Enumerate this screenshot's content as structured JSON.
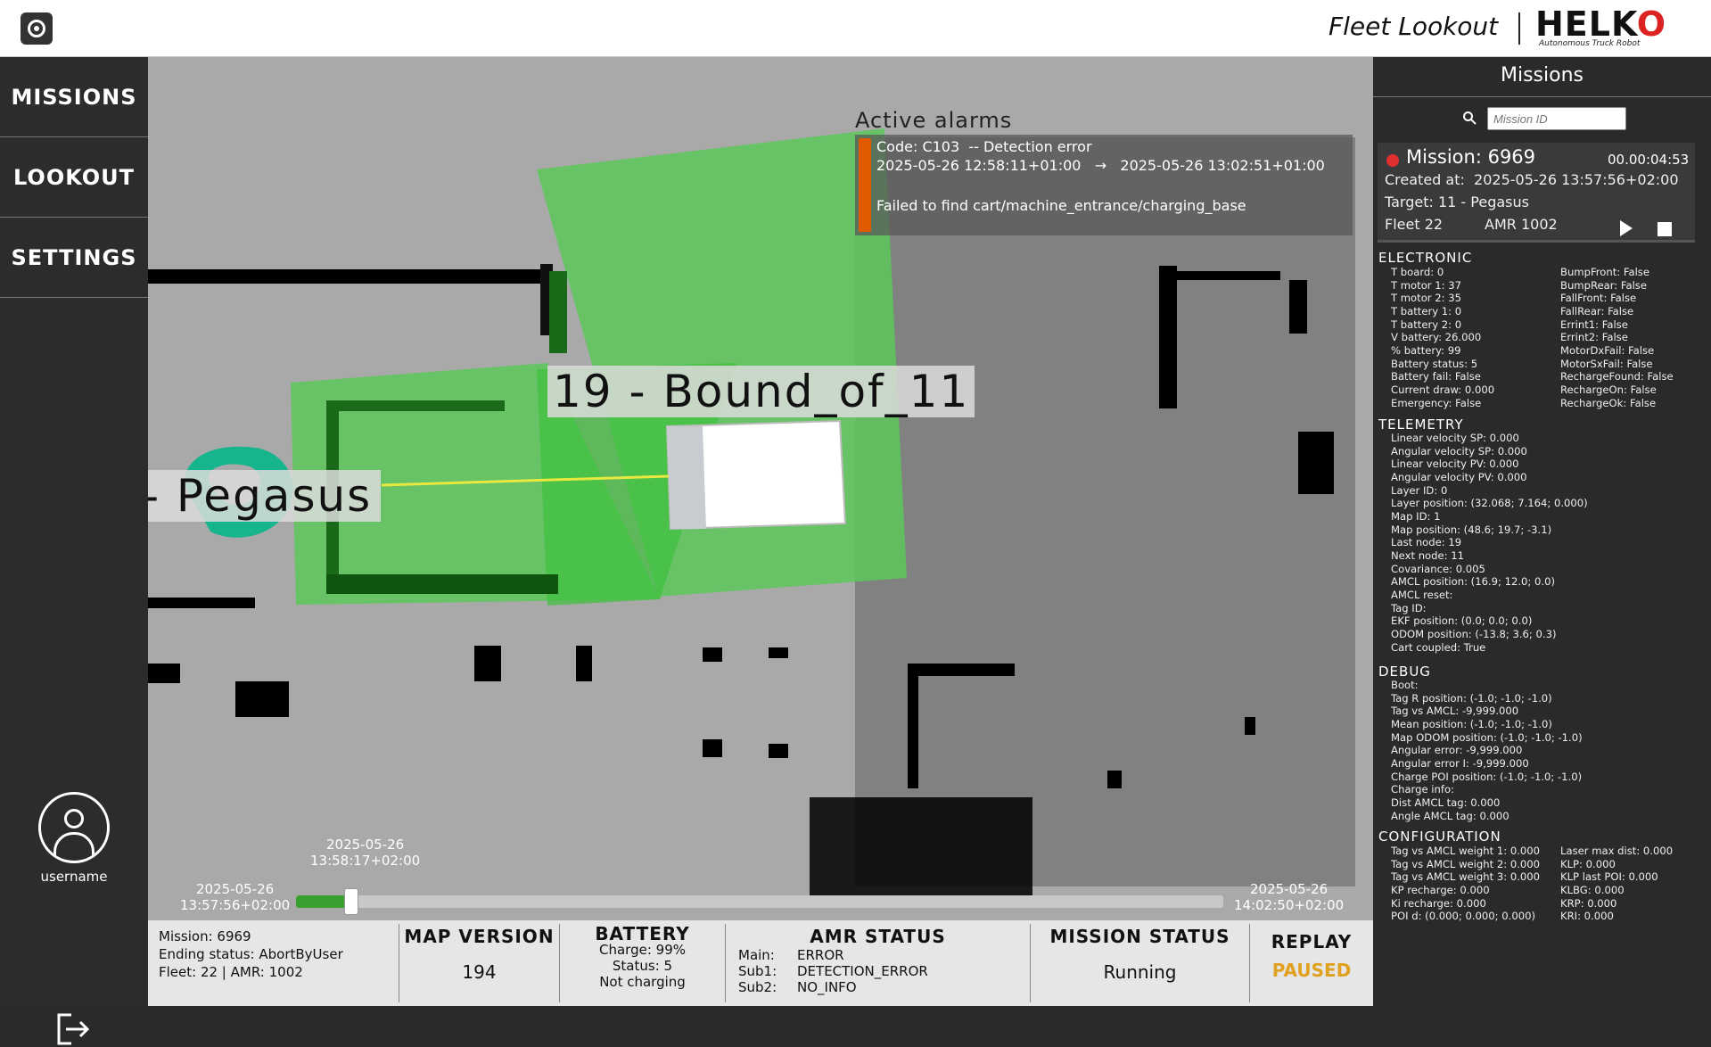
{
  "app": {
    "title": "Fleet Lookout",
    "brand": "HELKO",
    "brand_sub": "Autonomous Truck Robot"
  },
  "nav": {
    "items": [
      "MISSIONS",
      "LOOKOUT",
      "SETTINGS"
    ],
    "username": "username"
  },
  "alarms": {
    "title": "Active alarms",
    "code_label": "Code:",
    "code": "C103",
    "code_desc": "-- Detection error",
    "start": "2025-05-26 12:58:11+01:00",
    "arrow": "→",
    "end": "2025-05-26 13:02:51+01:00",
    "message": "Failed to find cart/machine_entrance/charging_base",
    "color": "#e05a00"
  },
  "map": {
    "node_label": "19 - Bound_of_11",
    "target_label": "- Pegasus"
  },
  "timeline": {
    "start_date": "2025-05-26",
    "start_time": "13:57:56+02:00",
    "end_date": "2025-05-26",
    "end_time": "14:02:50+02:00",
    "current_date": "2025-05-26",
    "current_time": "13:58:17+02:00",
    "progress": 0.06
  },
  "status": {
    "mission": [
      "Mission: 6969",
      "Ending status: AbortByUser",
      "Fleet: 22 | AMR: 1002"
    ],
    "map_version_label": "MAP VERSION",
    "map_version": "194",
    "battery_label": "BATTERY",
    "battery": [
      "Charge: 99%",
      "Status: 5",
      "Not charging"
    ],
    "amr_label": "AMR STATUS",
    "amr": [
      {
        "k": "Main:",
        "v": "ERROR"
      },
      {
        "k": "Sub1:",
        "v": "DETECTION_ERROR"
      },
      {
        "k": "Sub2:",
        "v": "NO_INFO"
      }
    ],
    "mission_status_label": "MISSION STATUS",
    "mission_status": "Running",
    "replay_label": "REPLAY",
    "replay": "PAUSED",
    "replay_color": "#e0a020"
  },
  "panel": {
    "title": "Missions",
    "search_placeholder": "Mission ID",
    "mission_name": "Mission: 6969",
    "mission_time": "00.00:04:53",
    "created_label": "Created at:",
    "created": "2025-05-26 13:57:56+02:00",
    "target": "Target: 11 - Pegasus",
    "fleet": "Fleet 22",
    "amr": "AMR 1002",
    "electronic_title": "ELECTRONIC",
    "electronic_left": [
      "T board: 0",
      "T motor 1: 37",
      "T motor 2: 35",
      "T battery 1: 0",
      "T battery 2: 0",
      "V battery: 26.000",
      "% battery: 99",
      "Battery status: 5",
      "Battery fail: False",
      "Current draw: 0.000",
      "Emergency: False"
    ],
    "electronic_right": [
      "BumpFront: False",
      "BumpRear: False",
      "FallFront: False",
      "FallRear: False",
      "Errint1: False",
      "Errint2: False",
      "MotorDxFail: False",
      "MotorSxFail: False",
      "RechargeFound: False",
      "RechargeOn: False",
      "RechargeOk: False"
    ],
    "telemetry_title": "TELEMETRY",
    "telemetry": [
      "Linear velocity SP: 0.000",
      "Angular velocity SP: 0.000",
      "Linear velocity PV: 0.000",
      "Angular velocity PV: 0.000",
      "Layer ID: 0",
      "Layer position: (32.068; 7.164; 0.000)",
      "Map ID: 1",
      "Map position: (48.6; 19.7; -3.1)",
      "Last node: 19",
      "Next node: 11",
      "Covariance: 0.005",
      "AMCL position: (16.9; 12.0; 0.0)",
      "AMCL reset:",
      "Tag ID:",
      "EKF position: (0.0; 0.0; 0.0)",
      "ODOM position: (-13.8; 3.6; 0.3)",
      "Cart coupled: True"
    ],
    "debug_title": "DEBUG",
    "debug": [
      "Boot:",
      "Tag R position: (-1.0; -1.0; -1.0)",
      "Tag vs AMCL: -9,999.000",
      "Mean position: (-1.0; -1.0; -1.0)",
      "Map ODOM position: (-1.0; -1.0; -1.0)",
      "Angular error: -9,999.000",
      "Angular error I: -9,999.000",
      "Charge POI position: (-1.0; -1.0; -1.0)",
      "Charge info:",
      "Dist AMCL tag: 0.000",
      "Angle AMCL tag: 0.000"
    ],
    "config_title": "CONFIGURATION",
    "config_left": [
      "Tag vs AMCL weight 1: 0.000",
      "Tag vs AMCL weight 2: 0.000",
      "Tag vs AMCL weight 3: 0.000",
      "KP recharge: 0.000",
      "Ki recharge: 0.000",
      "POI d: (0.000; 0.000; 0.000)"
    ],
    "config_right": [
      "Laser max dist: 0.000",
      "KLP: 0.000",
      "KLP last POI: 0.000",
      "KLBG: 0.000",
      "KRP: 0.000",
      "KRI: 0.000"
    ]
  }
}
